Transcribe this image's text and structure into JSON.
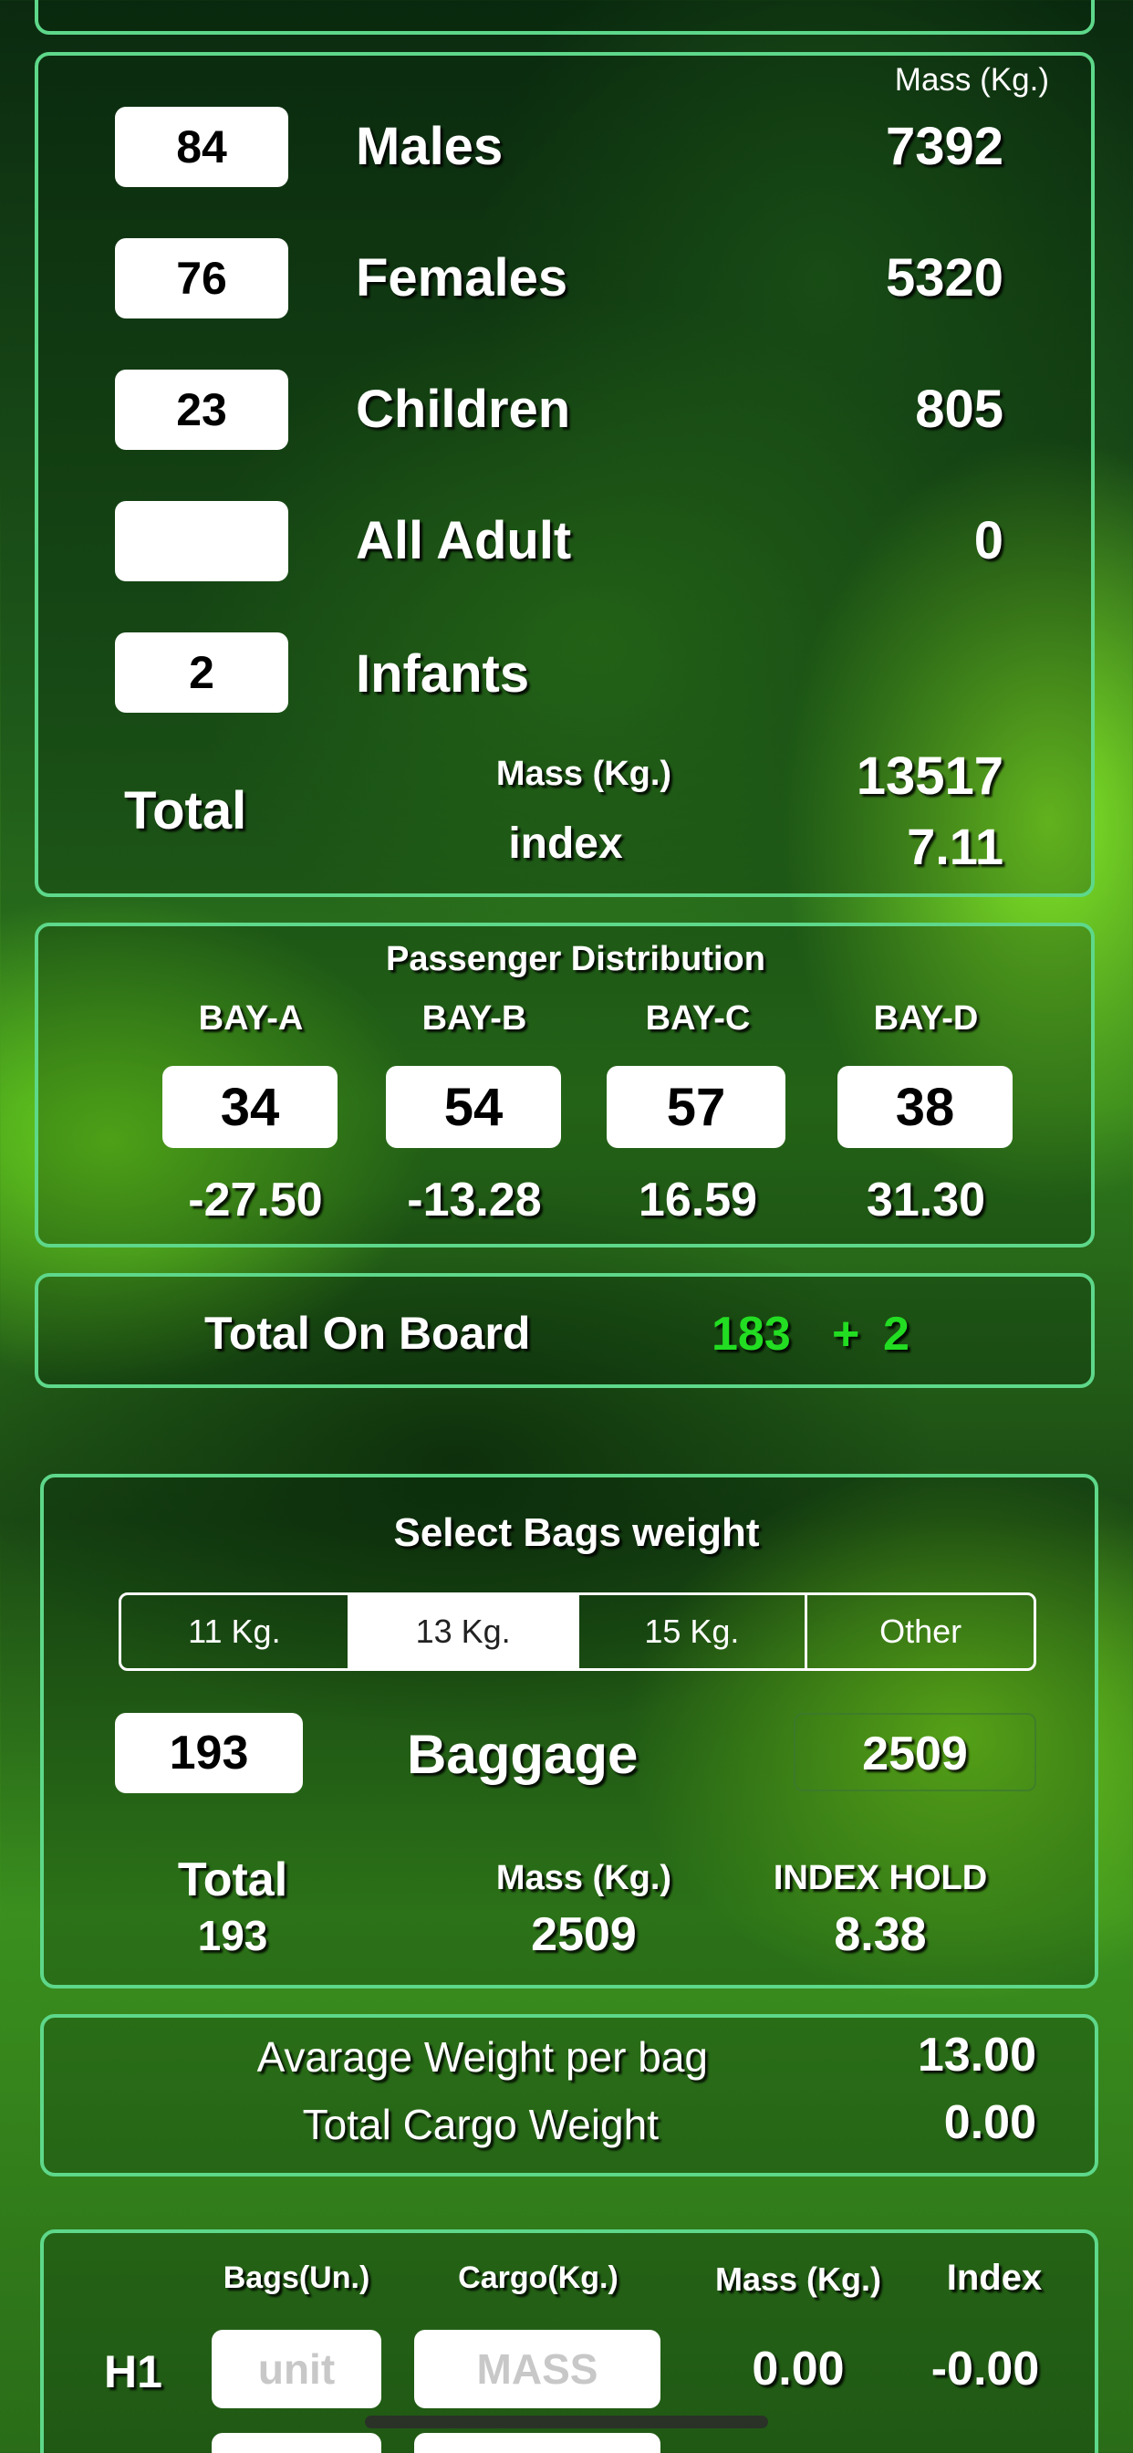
{
  "passengers": {
    "mass_header": "Mass (Kg.)",
    "rows": [
      {
        "count": "84",
        "label": "Males",
        "mass": "7392"
      },
      {
        "count": "76",
        "label": "Females",
        "mass": "5320"
      },
      {
        "count": "23",
        "label": "Children",
        "mass": "805"
      },
      {
        "count": "",
        "label": "All Adult",
        "mass": "0"
      },
      {
        "count": "2",
        "label": "Infants",
        "mass": ""
      }
    ],
    "total_label": "Total",
    "total_mass_label": "Mass (Kg.)",
    "total_mass": "13517",
    "index_label": "index",
    "index_value": "7.11"
  },
  "distribution": {
    "title": "Passenger Distribution",
    "bays": [
      {
        "name": "BAY-A",
        "count": "34",
        "index": "-27.50"
      },
      {
        "name": "BAY-B",
        "count": "54",
        "index": "-13.28"
      },
      {
        "name": "BAY-C",
        "count": "57",
        "index": "16.59"
      },
      {
        "name": "BAY-D",
        "count": "38",
        "index": "31.30"
      }
    ]
  },
  "onboard": {
    "label": "Total On Board",
    "value": "183",
    "plus": "+",
    "infants": "2",
    "accent_color": "#22dd22"
  },
  "bags": {
    "title": "Select Bags weight",
    "options": [
      "11 Kg.",
      "13 Kg.",
      "15 Kg.",
      "Other"
    ],
    "selected": "13 Kg.",
    "count": "193",
    "label": "Baggage",
    "mass": "2509",
    "total_label": "Total",
    "total_value": "193",
    "mass_label": "Mass (Kg.)",
    "mass_value": "2509",
    "index_hold_label": "INDEX HOLD",
    "index_hold_value": "8.38"
  },
  "averages": {
    "avg_label": "Avarage Weight per bag",
    "avg_value": "13.00",
    "cargo_label": "Total Cargo Weight",
    "cargo_value": "0.00"
  },
  "holds": {
    "headers": {
      "bags": "Bags(Un.)",
      "cargo": "Cargo(Kg.)",
      "mass": "Mass (Kg.)",
      "index": "Index"
    },
    "rows": [
      {
        "name": "H1",
        "unit_placeholder": "unit",
        "mass_placeholder": "MASS",
        "mass": "0.00",
        "index": "-0.00"
      }
    ]
  },
  "theme": {
    "border_color": "#5ed88a"
  }
}
